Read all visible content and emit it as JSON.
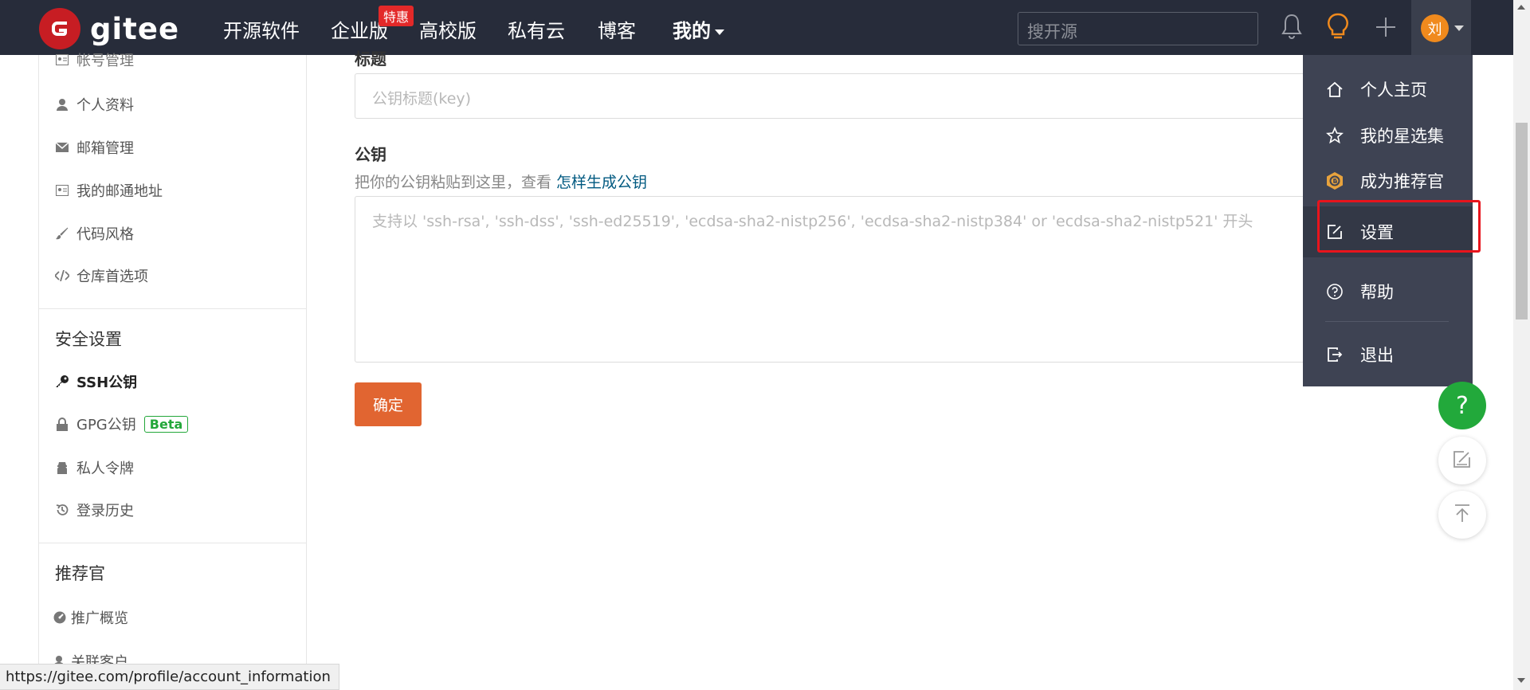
{
  "nav": {
    "brand": "gitee",
    "items": [
      "开源软件",
      "企业版",
      "高校版",
      "私有云",
      "博客",
      "我的"
    ],
    "badge": "特惠",
    "search_placeholder": "搜开源",
    "avatar_initial": "刘"
  },
  "sidebar": {
    "items_top": [
      "帐号管理",
      "个人资料",
      "邮箱管理",
      "我的邮通地址",
      "代码风格",
      "仓库首选项"
    ],
    "security_title": "安全设置",
    "security_items": [
      "SSH公钥",
      "GPG公钥",
      "私人令牌",
      "登录历史"
    ],
    "beta_label": "Beta",
    "recommend_title": "推荐官",
    "recommend_items": [
      "推广概览",
      "关联客户"
    ]
  },
  "form": {
    "title_label": "标题",
    "title_placeholder": "公钥标题(key)",
    "key_label": "公钥",
    "hint_text": "把你的公钥粘贴到这里，查看 ",
    "hint_link": "怎样生成公钥",
    "key_placeholder": "支持以 'ssh-rsa', 'ssh-dss', 'ssh-ed25519', 'ecdsa-sha2-nistp256', 'ecdsa-sha2-nistp384' or 'ecdsa-sha2-nistp521' 开头",
    "submit_label": "确定"
  },
  "dropdown": {
    "items": [
      "个人主页",
      "我的星选集",
      "成为推荐官",
      "设置",
      "帮助",
      "退出"
    ],
    "highlighted": "设置"
  },
  "float": {
    "help": "?"
  },
  "status_url": "https://gitee.com/profile/account_information",
  "colors": {
    "nav_bg": "#272c3a",
    "brand_red": "#c71d23",
    "submit": "#e16531",
    "help_green": "#22a93b",
    "link": "#005980",
    "highlight_frame": "#e8141c"
  }
}
